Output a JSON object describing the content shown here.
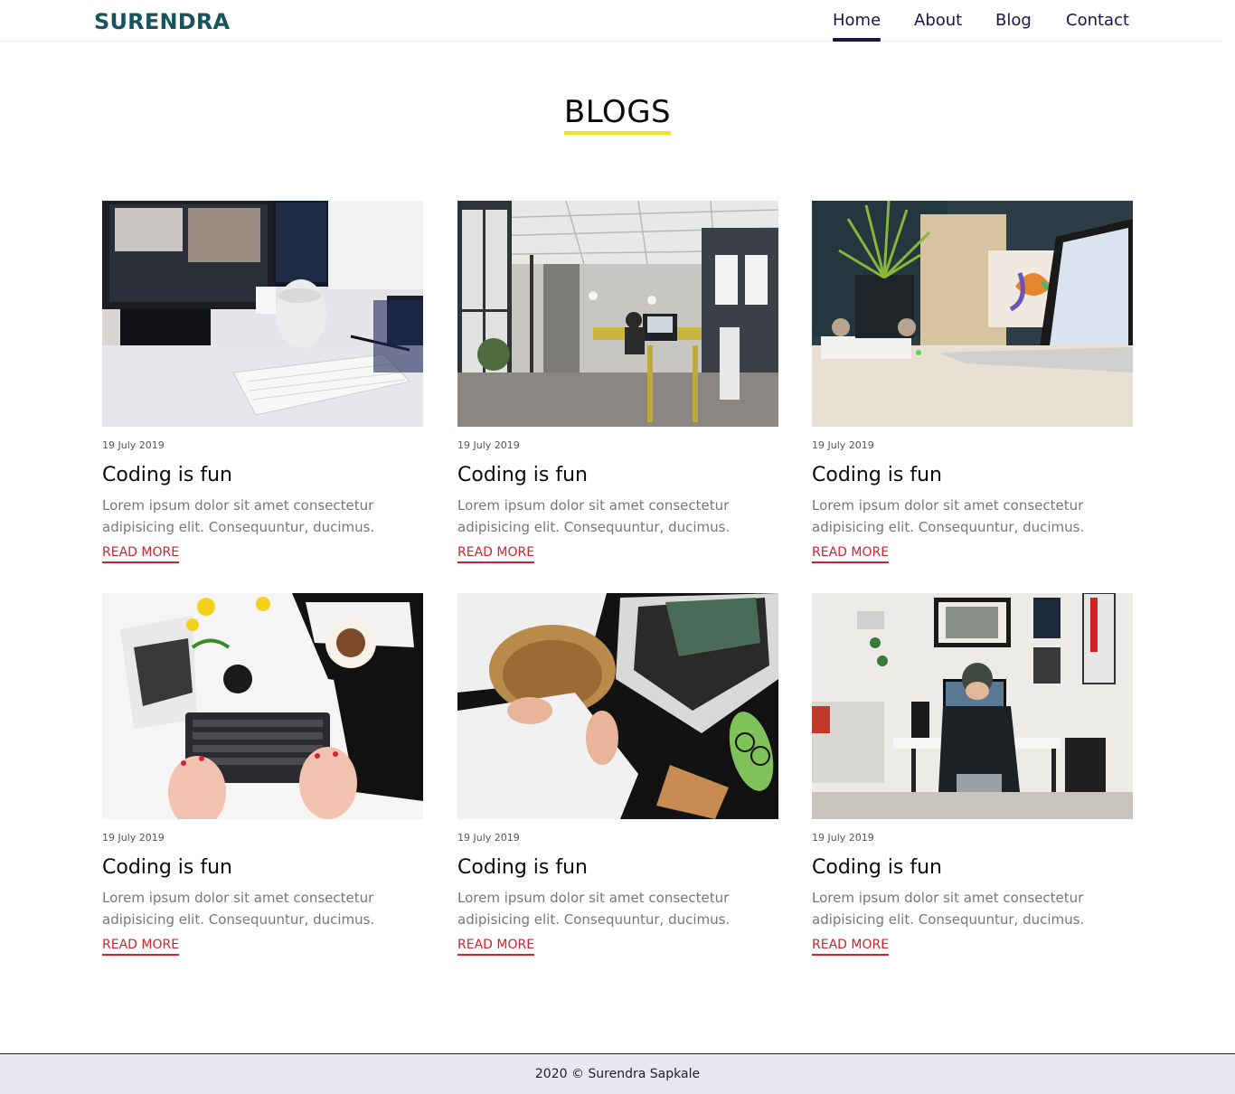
{
  "brand": "SURENDRA",
  "nav": {
    "items": [
      {
        "label": "Home",
        "active": true
      },
      {
        "label": "About",
        "active": false
      },
      {
        "label": "Blog",
        "active": false
      },
      {
        "label": "Contact",
        "active": false
      }
    ]
  },
  "section": {
    "title": "BLOGS"
  },
  "posts": [
    {
      "date": "19 July 2019",
      "title": "Coding is fun",
      "excerpt": "Lorem ipsum dolor sit amet consectetur adipisicing elit. Consequuntur, ducimus.",
      "link": "READ MORE",
      "image": "desk-monitors-keyboard-mug"
    },
    {
      "date": "19 July 2019",
      "title": "Coding is fun",
      "excerpt": "Lorem ipsum dolor sit amet consectetur adipisicing elit. Consequuntur, ducimus.",
      "link": "READ MORE",
      "image": "open-plan-office"
    },
    {
      "date": "19 July 2019",
      "title": "Coding is fun",
      "excerpt": "Lorem ipsum dolor sit amet consectetur adipisicing elit. Consequuntur, ducimus.",
      "link": "READ MORE",
      "image": "plant-and-laptop"
    },
    {
      "date": "19 July 2019",
      "title": "Coding is fun",
      "excerpt": "Lorem ipsum dolor sit amet consectetur adipisicing elit. Consequuntur, ducimus.",
      "link": "READ MORE",
      "image": "hands-typing-keyboard"
    },
    {
      "date": "19 July 2019",
      "title": "Coding is fun",
      "excerpt": "Lorem ipsum dolor sit amet consectetur adipisicing elit. Consequuntur, ducimus.",
      "link": "READ MORE",
      "image": "stressed-woman-laptop"
    },
    {
      "date": "19 July 2019",
      "title": "Coding is fun",
      "excerpt": "Lorem ipsum dolor sit amet consectetur adipisicing elit. Consequuntur, ducimus.",
      "link": "READ MORE",
      "image": "man-at-desk-workstation"
    }
  ],
  "footer": {
    "text": "2020 © Surendra Sapkale"
  },
  "colors": {
    "brand": "#17545d",
    "nav_text": "#1b1548",
    "title_underline": "#f2e41a",
    "link": "#d0232c",
    "footer_bg": "#e8e8f2"
  }
}
